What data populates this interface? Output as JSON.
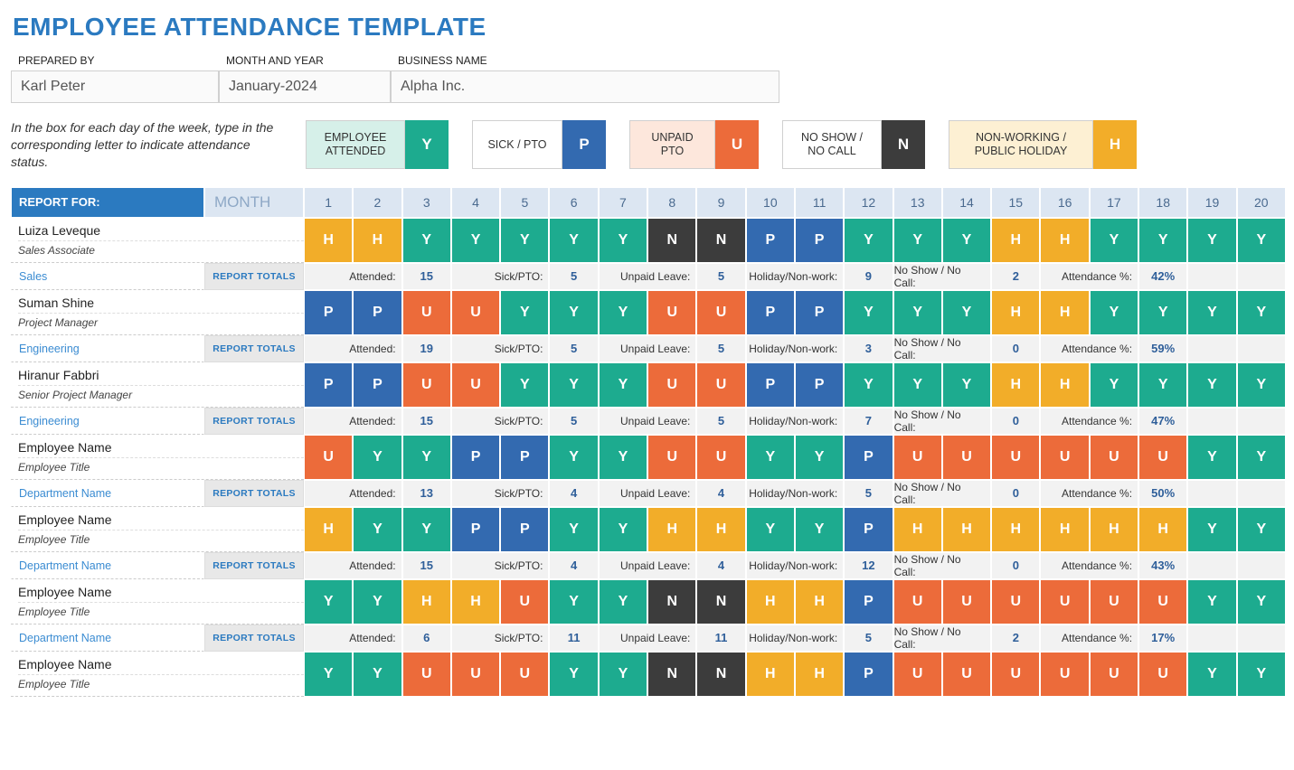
{
  "title": "EMPLOYEE ATTENDANCE TEMPLATE",
  "meta": {
    "prepared_label": "PREPARED BY",
    "prepared": "Karl Peter",
    "month_label": "MONTH AND YEAR",
    "month": "January-2024",
    "business_label": "BUSINESS NAME",
    "business": "Alpha Inc."
  },
  "legend": {
    "note": "In the box for each day of the week, type in the corresponding letter to indicate attendance status.",
    "items": [
      {
        "txt": "EMPLOYEE\nATTENDED",
        "code": "Y",
        "tcls": "lt-y",
        "ccls": "lc-y"
      },
      {
        "txt": "SICK / PTO",
        "code": "P",
        "tcls": "lt-p",
        "ccls": "lc-p"
      },
      {
        "txt": "UNPAID\nPTO",
        "code": "U",
        "tcls": "lt-u",
        "ccls": "lc-u"
      },
      {
        "txt": "NO SHOW /\nNO CALL",
        "code": "N",
        "tcls": "lt-n",
        "ccls": "lc-n"
      },
      {
        "txt": "NON-WORKING /\nPUBLIC HOLIDAY",
        "code": "H",
        "tcls": "lt-h",
        "ccls": "lc-h"
      }
    ]
  },
  "header": {
    "report_for": "REPORT FOR:",
    "period": "MONTH",
    "days": [
      "1",
      "2",
      "3",
      "4",
      "5",
      "6",
      "7",
      "8",
      "9",
      "10",
      "11",
      "12",
      "13",
      "14",
      "15",
      "16",
      "17",
      "18",
      "19",
      "20"
    ]
  },
  "totals_btn": "REPORT TOTALS",
  "tot_labels": {
    "attended": "Attended:",
    "sick": "Sick/PTO:",
    "unpaid": "Unpaid Leave:",
    "holiday": "Holiday/Non-work:",
    "noshow": "No Show / No Call:",
    "pct": "Attendance %:"
  },
  "employees": [
    {
      "name": "Luiza Leveque",
      "title": "Sales Associate",
      "dept": "Sales",
      "days": [
        "H",
        "H",
        "Y",
        "Y",
        "Y",
        "Y",
        "Y",
        "N",
        "N",
        "P",
        "P",
        "Y",
        "Y",
        "Y",
        "H",
        "H",
        "Y",
        "Y",
        "Y",
        "Y"
      ],
      "totals": {
        "attended": "15",
        "sick": "5",
        "unpaid": "5",
        "holiday": "9",
        "noshow": "2",
        "pct": "42%"
      }
    },
    {
      "name": "Suman Shine",
      "title": "Project Manager",
      "dept": "Engineering",
      "days": [
        "P",
        "P",
        "U",
        "U",
        "Y",
        "Y",
        "Y",
        "U",
        "U",
        "P",
        "P",
        "Y",
        "Y",
        "Y",
        "H",
        "H",
        "Y",
        "Y",
        "Y",
        "Y"
      ],
      "totals": {
        "attended": "19",
        "sick": "5",
        "unpaid": "5",
        "holiday": "3",
        "noshow": "0",
        "pct": "59%"
      }
    },
    {
      "name": "Hiranur Fabbri",
      "title": "Senior Project Manager",
      "dept": "Engineering",
      "days": [
        "P",
        "P",
        "U",
        "U",
        "Y",
        "Y",
        "Y",
        "U",
        "U",
        "P",
        "P",
        "Y",
        "Y",
        "Y",
        "H",
        "H",
        "Y",
        "Y",
        "Y",
        "Y"
      ],
      "totals": {
        "attended": "15",
        "sick": "5",
        "unpaid": "5",
        "holiday": "7",
        "noshow": "0",
        "pct": "47%"
      }
    },
    {
      "name": "Employee Name",
      "title": "Employee Title",
      "dept": "Department Name",
      "days": [
        "U",
        "Y",
        "Y",
        "P",
        "P",
        "Y",
        "Y",
        "U",
        "U",
        "Y",
        "Y",
        "P",
        "U",
        "U",
        "U",
        "U",
        "U",
        "U",
        "Y",
        "Y"
      ],
      "totals": {
        "attended": "13",
        "sick": "4",
        "unpaid": "4",
        "holiday": "5",
        "noshow": "0",
        "pct": "50%"
      }
    },
    {
      "name": "Employee Name",
      "title": "Employee Title",
      "dept": "Department Name",
      "days": [
        "H",
        "Y",
        "Y",
        "P",
        "P",
        "Y",
        "Y",
        "H",
        "H",
        "Y",
        "Y",
        "P",
        "H",
        "H",
        "H",
        "H",
        "H",
        "H",
        "Y",
        "Y"
      ],
      "totals": {
        "attended": "15",
        "sick": "4",
        "unpaid": "4",
        "holiday": "12",
        "noshow": "0",
        "pct": "43%"
      }
    },
    {
      "name": "Employee Name",
      "title": "Employee Title",
      "dept": "Department Name",
      "days": [
        "Y",
        "Y",
        "H",
        "H",
        "U",
        "Y",
        "Y",
        "N",
        "N",
        "H",
        "H",
        "P",
        "U",
        "U",
        "U",
        "U",
        "U",
        "U",
        "Y",
        "Y"
      ],
      "totals": {
        "attended": "6",
        "sick": "11",
        "unpaid": "11",
        "holiday": "5",
        "noshow": "2",
        "pct": "17%"
      }
    },
    {
      "name": "Employee Name",
      "title": "Employee Title",
      "dept": "Department Name",
      "days": [
        "Y",
        "Y",
        "U",
        "U",
        "U",
        "Y",
        "Y",
        "N",
        "N",
        "H",
        "H",
        "P",
        "U",
        "U",
        "U",
        "U",
        "U",
        "U",
        "Y",
        "Y"
      ],
      "totals": null
    }
  ],
  "chart_data": {
    "type": "table",
    "columns": [
      "Employee",
      "Attended",
      "Sick/PTO",
      "Unpaid Leave",
      "Holiday/Non-work",
      "No Show / No Call",
      "Attendance %"
    ],
    "rows": [
      [
        "Luiza Leveque",
        15,
        5,
        5,
        9,
        2,
        "42%"
      ],
      [
        "Suman Shine",
        19,
        5,
        5,
        3,
        0,
        "59%"
      ],
      [
        "Hiranur Fabbri",
        15,
        5,
        5,
        7,
        0,
        "47%"
      ],
      [
        "Employee Name",
        13,
        4,
        4,
        5,
        0,
        "50%"
      ],
      [
        "Employee Name",
        15,
        4,
        4,
        12,
        0,
        "43%"
      ],
      [
        "Employee Name",
        6,
        11,
        11,
        5,
        2,
        "17%"
      ]
    ]
  }
}
